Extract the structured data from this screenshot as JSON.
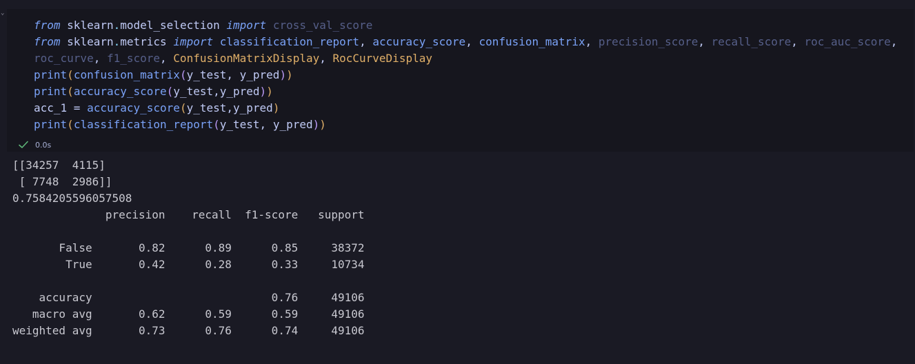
{
  "cell": {
    "code_lines": [
      [
        {
          "t": "from",
          "c": "kw"
        },
        {
          "t": " ",
          "c": "punct"
        },
        {
          "t": "sklearn",
          "c": "mod"
        },
        {
          "t": ".",
          "c": "dot"
        },
        {
          "t": "model_selection",
          "c": "mod"
        },
        {
          "t": " ",
          "c": "punct"
        },
        {
          "t": "import",
          "c": "kw"
        },
        {
          "t": " ",
          "c": "punct"
        },
        {
          "t": "cross_val_score",
          "c": "unused"
        }
      ],
      [
        {
          "t": "from",
          "c": "kw"
        },
        {
          "t": " ",
          "c": "punct"
        },
        {
          "t": "sklearn",
          "c": "mod"
        },
        {
          "t": ".",
          "c": "dot"
        },
        {
          "t": "metrics",
          "c": "mod"
        },
        {
          "t": " ",
          "c": "punct"
        },
        {
          "t": "import",
          "c": "kw"
        },
        {
          "t": " ",
          "c": "punct"
        },
        {
          "t": "classification_report",
          "c": "fn"
        },
        {
          "t": ", ",
          "c": "punct"
        },
        {
          "t": "accuracy_score",
          "c": "fn"
        },
        {
          "t": ", ",
          "c": "punct"
        },
        {
          "t": "confusion_matrix",
          "c": "fn"
        },
        {
          "t": ", ",
          "c": "punct"
        },
        {
          "t": "precision_score",
          "c": "unused"
        },
        {
          "t": ", ",
          "c": "punct"
        },
        {
          "t": "recall_score",
          "c": "unused"
        },
        {
          "t": ", ",
          "c": "punct"
        },
        {
          "t": "roc_auc_score",
          "c": "unused"
        },
        {
          "t": ",",
          "c": "punct"
        }
      ],
      [
        {
          "t": "roc_curve",
          "c": "unused"
        },
        {
          "t": ", ",
          "c": "punct"
        },
        {
          "t": "f1_score",
          "c": "unused"
        },
        {
          "t": ", ",
          "c": "punct"
        },
        {
          "t": "ConfusionMatrixDisplay",
          "c": "cls"
        },
        {
          "t": ", ",
          "c": "punct"
        },
        {
          "t": "RocCurveDisplay",
          "c": "cls"
        }
      ],
      [
        {
          "t": "print",
          "c": "fn"
        },
        {
          "t": "(",
          "c": "paren1"
        },
        {
          "t": "confusion_matrix",
          "c": "fn"
        },
        {
          "t": "(",
          "c": "paren2"
        },
        {
          "t": "y_test",
          "c": "var"
        },
        {
          "t": ", ",
          "c": "punct"
        },
        {
          "t": "y_pred",
          "c": "var"
        },
        {
          "t": ")",
          "c": "paren2"
        },
        {
          "t": ")",
          "c": "paren1"
        }
      ],
      [
        {
          "t": "print",
          "c": "fn"
        },
        {
          "t": "(",
          "c": "paren1"
        },
        {
          "t": "accuracy_score",
          "c": "fn"
        },
        {
          "t": "(",
          "c": "paren2"
        },
        {
          "t": "y_test",
          "c": "var"
        },
        {
          "t": ",",
          "c": "punct"
        },
        {
          "t": "y_pred",
          "c": "var"
        },
        {
          "t": ")",
          "c": "paren2"
        },
        {
          "t": ")",
          "c": "paren1"
        }
      ],
      [
        {
          "t": "acc_1",
          "c": "var"
        },
        {
          "t": " = ",
          "c": "op"
        },
        {
          "t": "accuracy_score",
          "c": "fn"
        },
        {
          "t": "(",
          "c": "paren1"
        },
        {
          "t": "y_test",
          "c": "var"
        },
        {
          "t": ",",
          "c": "punct"
        },
        {
          "t": "y_pred",
          "c": "var"
        },
        {
          "t": ")",
          "c": "paren1"
        }
      ],
      [
        {
          "t": "print",
          "c": "fn"
        },
        {
          "t": "(",
          "c": "paren1"
        },
        {
          "t": "classification_report",
          "c": "fn"
        },
        {
          "t": "(",
          "c": "paren2"
        },
        {
          "t": "y_test",
          "c": "var"
        },
        {
          "t": ", ",
          "c": "punct"
        },
        {
          "t": "y_pred",
          "c": "var"
        },
        {
          "t": ")",
          "c": "paren2"
        },
        {
          "t": ")",
          "c": "paren1"
        }
      ]
    ],
    "status": {
      "icon": "check-icon",
      "time": "0.0s",
      "success_color": "#5fb87a"
    }
  },
  "output": {
    "lines": [
      "[[34257  4115]",
      " [ 7748  2986]]",
      "0.7584205596057508",
      "              precision    recall  f1-score   support",
      "",
      "       False       0.82      0.89      0.85     38372",
      "        True       0.42      0.28      0.33     10734",
      "",
      "    accuracy                           0.76     49106",
      "   macro avg       0.62      0.59      0.59     49106",
      "weighted avg       0.73      0.76      0.74     49106"
    ]
  },
  "colors": {
    "background": "#1a1a24",
    "cell_background": "#16161e",
    "keyword": "#7aa2f7",
    "function": "#7aa2f7",
    "unused_import": "#565f89",
    "class_name": "#e0af68",
    "output_text": "#c8c8d0"
  }
}
